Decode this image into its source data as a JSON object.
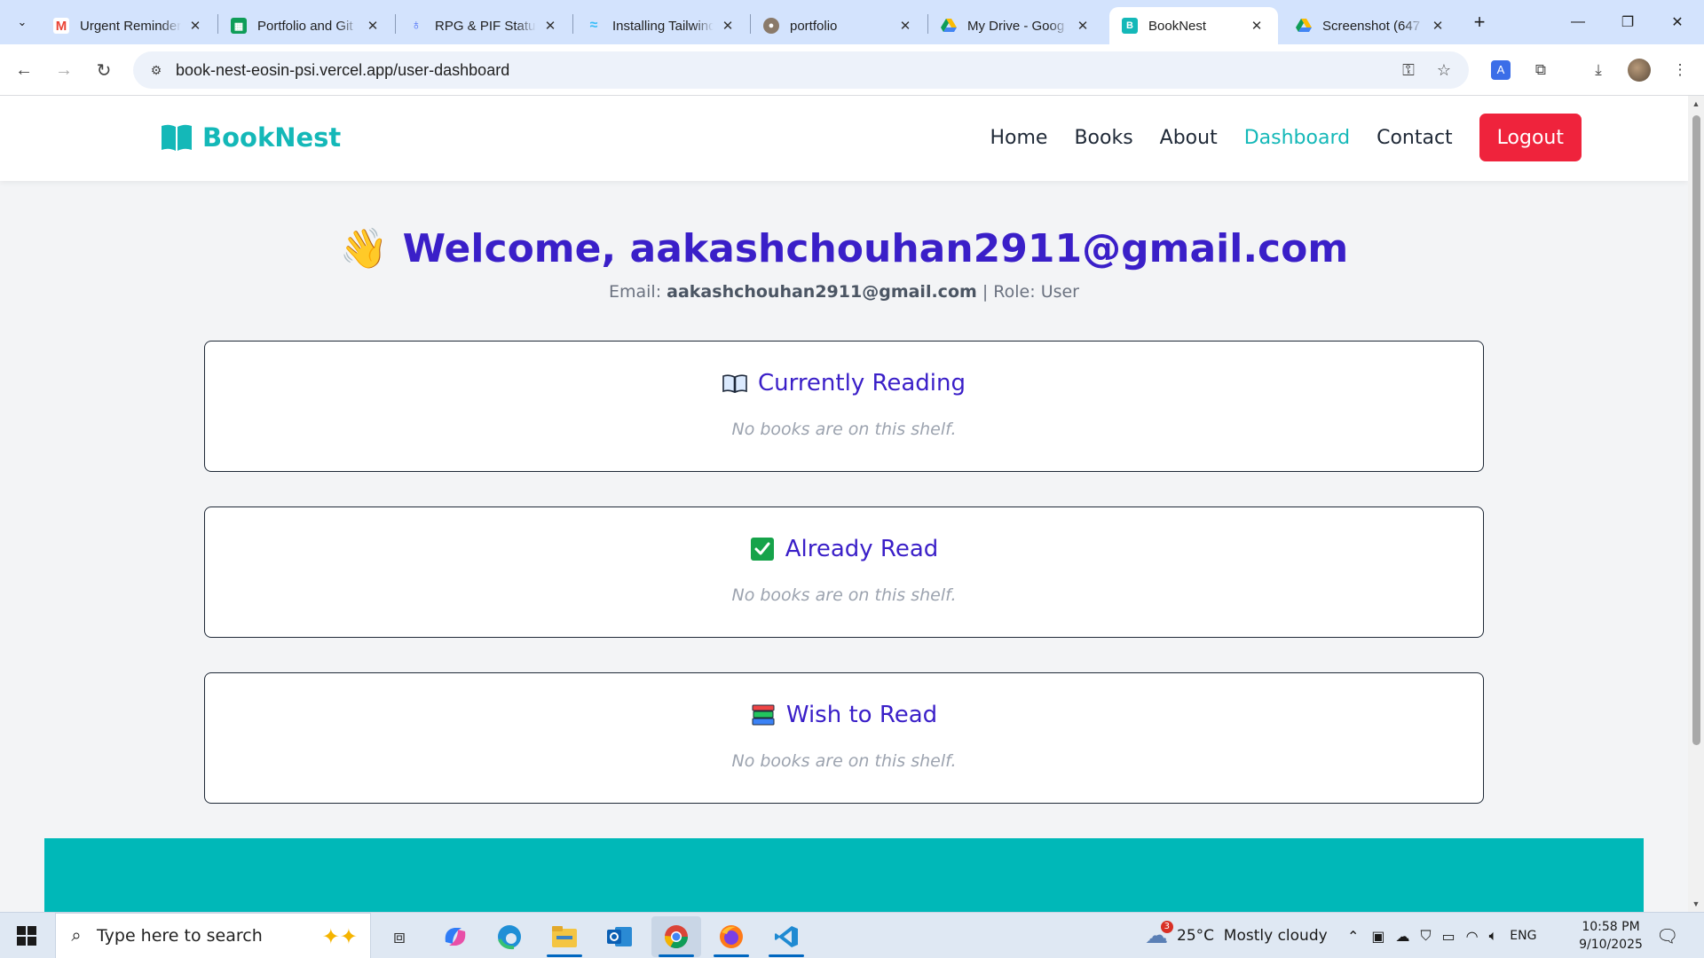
{
  "browser": {
    "tabs": [
      {
        "title": "Urgent Reminder",
        "favicon": "gmail-icon"
      },
      {
        "title": "Portfolio and Git",
        "favicon": "sheets-icon"
      },
      {
        "title": "RPG & PIF Status",
        "favicon": "clickup-icon"
      },
      {
        "title": "Installing Tailwind",
        "favicon": "tailwind-icon"
      },
      {
        "title": "portfolio",
        "favicon": "github-icon"
      },
      {
        "title": "My Drive - Goog",
        "favicon": "drive-icon"
      },
      {
        "title": "BookNest",
        "favicon": "booknest-icon",
        "active": true
      },
      {
        "title": "Screenshot (647",
        "favicon": "drive-icon"
      }
    ],
    "url": "book-nest-eosin-psi.vercel.app/user-dashboard"
  },
  "site": {
    "brand": "BookNest",
    "nav": {
      "home": "Home",
      "books": "Books",
      "about": "About",
      "dashboard": "Dashboard",
      "contact": "Contact",
      "logout": "Logout"
    },
    "welcome": {
      "emoji": "👋",
      "text": "Welcome, aakashchouhan2911@gmail.com"
    },
    "info": {
      "email_label": "Email:",
      "email": "aakashchouhan2911@gmail.com",
      "separator": "|",
      "role_label": "Role:",
      "role": "User"
    },
    "shelves": [
      {
        "title": "Currently Reading",
        "icon": "open-book-icon",
        "empty": "No books are on this shelf."
      },
      {
        "title": "Already Read",
        "icon": "check-mark-icon",
        "empty": "No books are on this shelf."
      },
      {
        "title": "Wish to Read",
        "icon": "books-stack-icon",
        "empty": "No books are on this shelf."
      }
    ]
  },
  "taskbar": {
    "search_placeholder": "Type here to search",
    "weather": "25°C  Mostly cloudy",
    "weather_badge": "3",
    "language": "ENG",
    "time": "10:58 PM",
    "date": "9/10/2025"
  },
  "colors": {
    "brand_teal": "#14b8b8",
    "heading_indigo": "#3a1fc8",
    "logout_red": "#ef233c",
    "footer_teal": "#00b8b8"
  }
}
